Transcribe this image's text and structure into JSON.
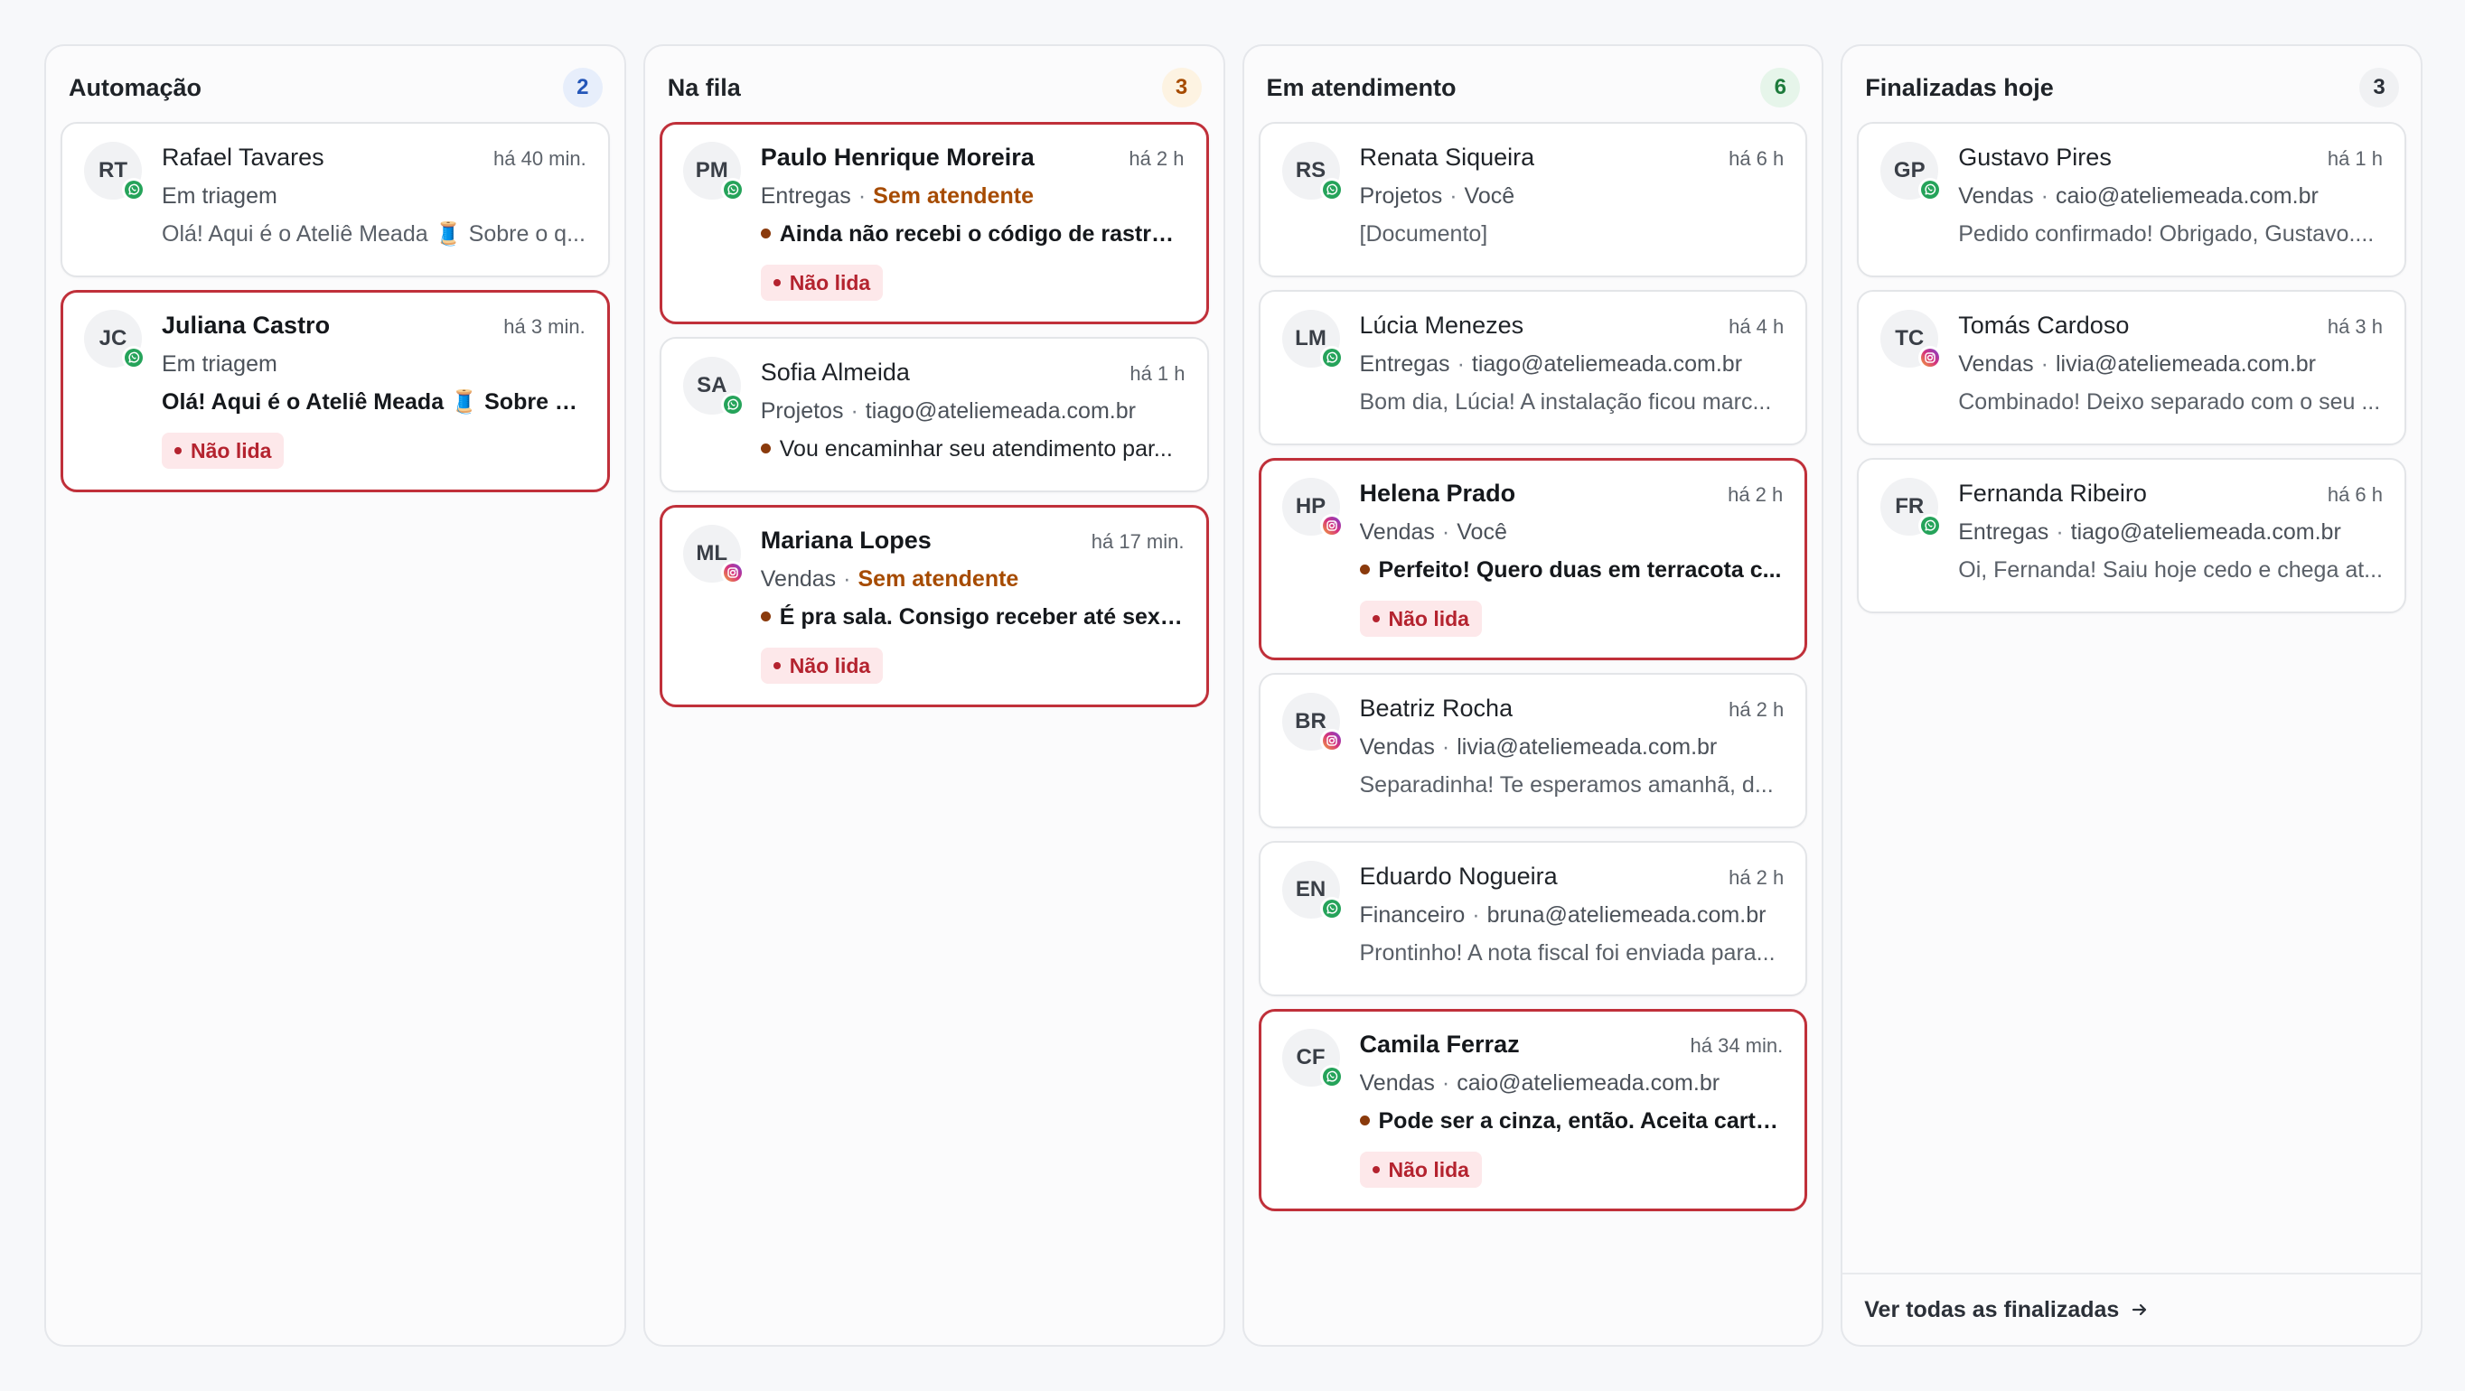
{
  "colors": {
    "unread_border": "#c0303a",
    "unread_badge_bg": "#fde8ea",
    "unread_badge_text": "#b4232f",
    "warn_text": "#a64b00",
    "whatsapp": "#25a35a",
    "instagram": "#d6327c"
  },
  "columns": [
    {
      "title": "Automação",
      "count": "2",
      "count_bg": "#e7eefb",
      "count_color": "#2456b8",
      "cards": [
        {
          "initials": "RT",
          "channel": "whatsapp-icon",
          "name": "Rafael Tavares",
          "time": "há 40 min.",
          "dept": "Em triagem",
          "agent": "",
          "agent_warn": false,
          "preview": "Olá! Aqui é o Ateliê Meada 🧵 Sobre o q...",
          "unread": false,
          "dot": false
        },
        {
          "initials": "JC",
          "channel": "whatsapp-icon",
          "name": "Juliana Castro",
          "time": "há 3 min.",
          "dept": "Em triagem",
          "agent": "",
          "agent_warn": false,
          "preview": "Olá! Aqui é o Ateliê Meada 🧵 Sobre o ...",
          "unread": true,
          "dot": false,
          "badge": "Não lida"
        }
      ]
    },
    {
      "title": "Na fila",
      "count": "3",
      "count_bg": "#fdf3e2",
      "count_color": "#a64b00",
      "cards": [
        {
          "initials": "PM",
          "channel": "whatsapp-icon",
          "name": "Paulo Henrique Moreira",
          "time": "há 2 h",
          "dept": "Entregas",
          "agent": "Sem atendente",
          "agent_warn": true,
          "preview": "Ainda não recebi o código de rastrei...",
          "unread": true,
          "dot": true,
          "badge": "Não lida"
        },
        {
          "initials": "SA",
          "channel": "whatsapp-icon",
          "name": "Sofia Almeida",
          "time": "há 1 h",
          "dept": "Projetos",
          "agent": "tiago@ateliemeada.com.br",
          "agent_warn": false,
          "preview": "Vou encaminhar seu atendimento par...",
          "unread": false,
          "dot": true
        },
        {
          "initials": "ML",
          "channel": "instagram-icon",
          "name": "Mariana Lopes",
          "time": "há 17 min.",
          "dept": "Vendas",
          "agent": "Sem atendente",
          "agent_warn": true,
          "preview": "É pra sala. Consigo receber até sexta?",
          "unread": true,
          "dot": true,
          "badge": "Não lida"
        }
      ]
    },
    {
      "title": "Em atendimento",
      "count": "6",
      "count_bg": "#e6f5ea",
      "count_color": "#1e7b3c",
      "cards": [
        {
          "initials": "RS",
          "channel": "whatsapp-icon",
          "name": "Renata Siqueira",
          "time": "há 6 h",
          "dept": "Projetos",
          "agent": "Você",
          "agent_warn": false,
          "preview": "[Documento]",
          "unread": false,
          "dot": false
        },
        {
          "initials": "LM",
          "channel": "whatsapp-icon",
          "name": "Lúcia Menezes",
          "time": "há 4 h",
          "dept": "Entregas",
          "agent": "tiago@ateliemeada.com.br",
          "agent_warn": false,
          "preview": "Bom dia, Lúcia! A instalação ficou marc...",
          "unread": false,
          "dot": false
        },
        {
          "initials": "HP",
          "channel": "instagram-icon",
          "name": "Helena Prado",
          "time": "há 2 h",
          "dept": "Vendas",
          "agent": "Você",
          "agent_warn": false,
          "preview": "Perfeito! Quero duas em terracota c...",
          "unread": true,
          "dot": true,
          "badge": "Não lida"
        },
        {
          "initials": "BR",
          "channel": "instagram-icon",
          "name": "Beatriz Rocha",
          "time": "há 2 h",
          "dept": "Vendas",
          "agent": "livia@ateliemeada.com.br",
          "agent_warn": false,
          "preview": "Separadinha! Te esperamos amanhã, d...",
          "unread": false,
          "dot": false
        },
        {
          "initials": "EN",
          "channel": "whatsapp-icon",
          "name": "Eduardo Nogueira",
          "time": "há 2 h",
          "dept": "Financeiro",
          "agent": "bruna@ateliemeada.com.br",
          "agent_warn": false,
          "preview": "Prontinho! A nota fiscal foi enviada para...",
          "unread": false,
          "dot": false
        },
        {
          "initials": "CF",
          "channel": "whatsapp-icon",
          "name": "Camila Ferraz",
          "time": "há 34 min.",
          "dept": "Vendas",
          "agent": "caio@ateliemeada.com.br",
          "agent_warn": false,
          "preview": "Pode ser a cinza, então. Aceita cartã...",
          "unread": true,
          "dot": true,
          "badge": "Não lida"
        }
      ]
    },
    {
      "title": "Finalizadas hoje",
      "count": "3",
      "count_bg": "#f0f1f3",
      "count_color": "#2b3038",
      "footer": "Ver todas as finalizadas",
      "cards": [
        {
          "initials": "GP",
          "channel": "whatsapp-icon",
          "name": "Gustavo Pires",
          "time": "há 1 h",
          "dept": "Vendas",
          "agent": "caio@ateliemeada.com.br",
          "agent_warn": false,
          "preview": "Pedido confirmado! Obrigado, Gustavo....",
          "unread": false,
          "dot": false
        },
        {
          "initials": "TC",
          "channel": "instagram-icon",
          "name": "Tomás Cardoso",
          "time": "há 3 h",
          "dept": "Vendas",
          "agent": "livia@ateliemeada.com.br",
          "agent_warn": false,
          "preview": "Combinado! Deixo separado com o seu ...",
          "unread": false,
          "dot": false
        },
        {
          "initials": "FR",
          "channel": "whatsapp-icon",
          "name": "Fernanda Ribeiro",
          "time": "há 6 h",
          "dept": "Entregas",
          "agent": "tiago@ateliemeada.com.br",
          "agent_warn": false,
          "preview": "Oi, Fernanda! Saiu hoje cedo e chega at...",
          "unread": false,
          "dot": false
        }
      ]
    }
  ]
}
